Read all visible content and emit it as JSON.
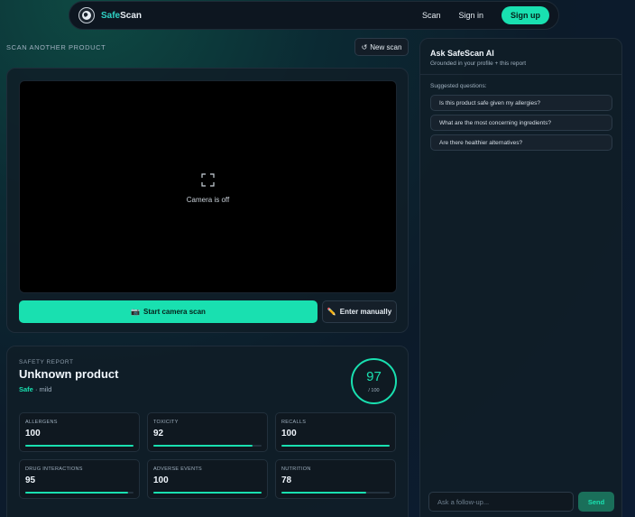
{
  "nav": {
    "brand_a": "Safe",
    "brand_b": "Scan",
    "links": [
      "Scan",
      "Sign in"
    ],
    "signup": "Sign up"
  },
  "scan": {
    "section_title": "SCAN ANOTHER PRODUCT",
    "new_scan": "New scan",
    "camera_status": "Camera is off",
    "start_button": "Start camera scan",
    "manual_button": "Enter manually"
  },
  "report": {
    "label": "SAFETY REPORT",
    "product_name": "Unknown product",
    "status": "Safe",
    "severity": "· mild",
    "score": "97",
    "score_max": "/ 100",
    "metrics": [
      {
        "label": "ALLERGENS",
        "value": "100",
        "fill": 100
      },
      {
        "label": "TOXICITY",
        "value": "92",
        "fill": 92
      },
      {
        "label": "RECALLS",
        "value": "100",
        "fill": 100
      },
      {
        "label": "DRUG INTERACTIONS",
        "value": "95",
        "fill": 95
      },
      {
        "label": "ADVERSE EVENTS",
        "value": "100",
        "fill": 100
      },
      {
        "label": "NUTRITION",
        "value": "78",
        "fill": 78
      }
    ]
  },
  "chat": {
    "title": "Ask SafeScan AI",
    "subtitle": "Grounded in your profile + this report",
    "suggest_label": "Suggested questions:",
    "suggestions": [
      "Is this product safe given my allergies?",
      "What are the most concerning ingredients?",
      "Are there healthier alternatives?"
    ],
    "input_placeholder": "Ask a follow-up...",
    "send": "Send"
  },
  "colors": {
    "accent": "#19e0b0",
    "brand": "#2fd3c6"
  }
}
